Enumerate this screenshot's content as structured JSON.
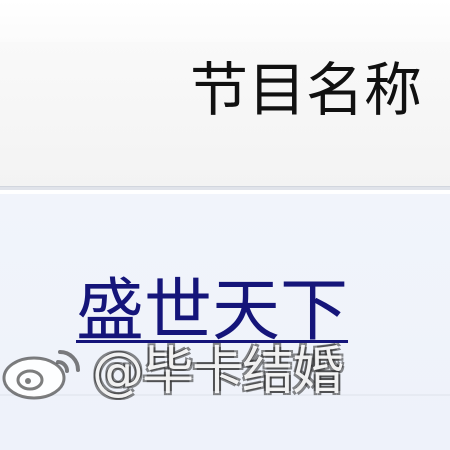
{
  "table": {
    "header": {
      "column_label": "节目名称"
    },
    "rows": [
      {
        "program_name": "盛世天下"
      }
    ]
  },
  "watermark": {
    "text": "@毕卡结婚",
    "logo_icon": "weibo-logo-icon"
  },
  "colors": {
    "header_bg": "#f5f5f5",
    "row_bg": "#eff3fb",
    "link_text": "#15157a",
    "header_text": "#111111"
  }
}
